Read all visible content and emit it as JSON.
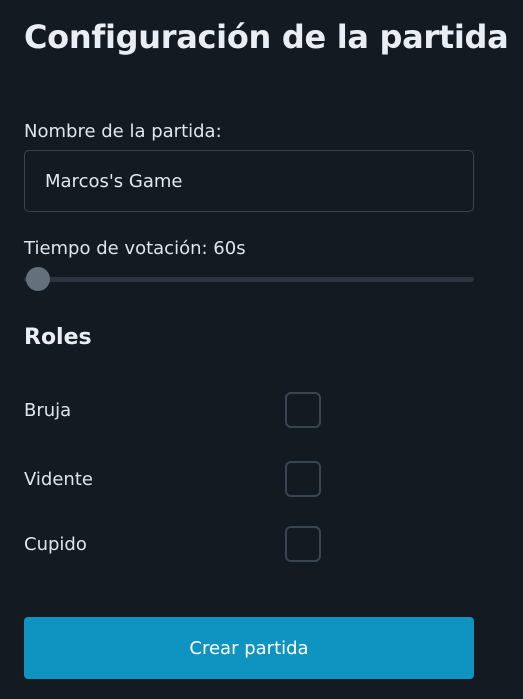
{
  "page": {
    "title": "Configuración de la partida"
  },
  "game_name": {
    "label": "Nombre de la partida:",
    "value": "Marcos's Game"
  },
  "vote_time": {
    "label": "Tiempo de votación: 60s",
    "slider_fraction": 0
  },
  "roles": {
    "heading": "Roles",
    "items": [
      {
        "label": "Bruja",
        "checked": false
      },
      {
        "label": "Vidente",
        "checked": false
      },
      {
        "label": "Cupido",
        "checked": false
      }
    ]
  },
  "actions": {
    "create_label": "Crear partida"
  },
  "colors": {
    "background": "#131a22",
    "accent": "#0f94c2",
    "slider_thumb": "#64707c",
    "border": "#3a4450"
  }
}
